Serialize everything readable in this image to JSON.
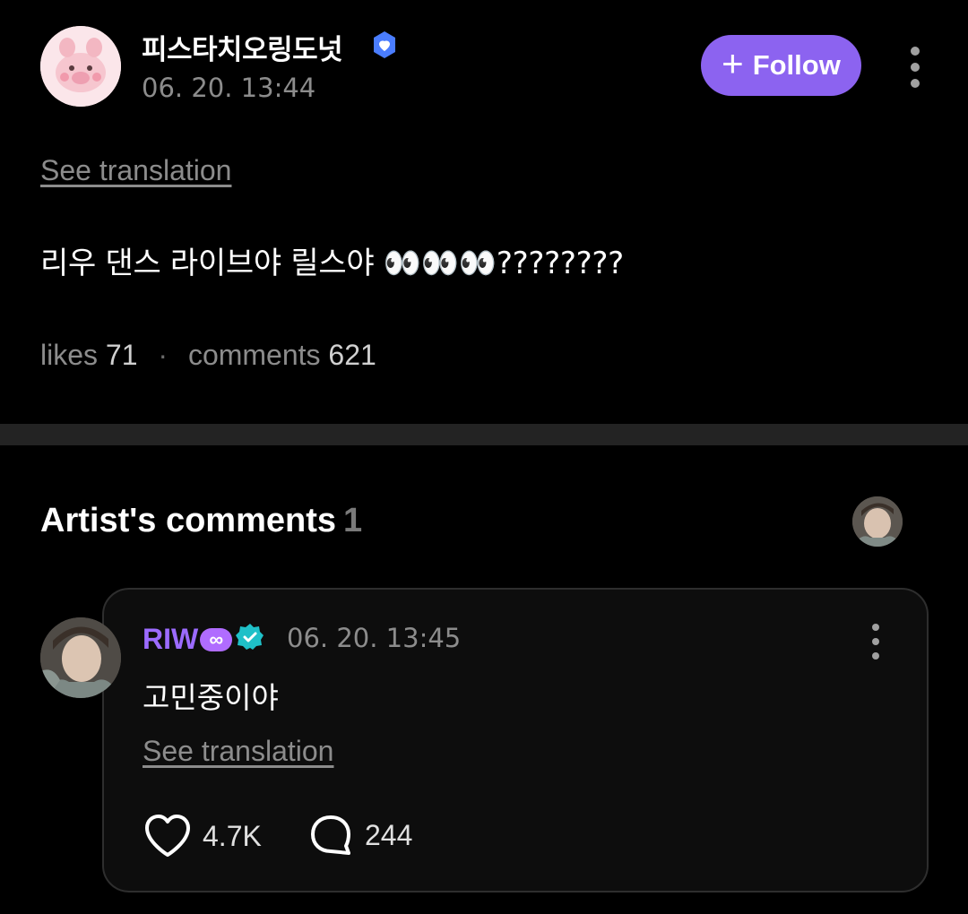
{
  "post": {
    "author": "피스타치오링도넛",
    "timestamp": "06. 20. 13:44",
    "follow_label": "Follow",
    "see_translation": "See translation",
    "body": "리우 댄스 라이브야 릴스야 👀👀👀????????",
    "likes_label": "likes",
    "likes_count": "71",
    "comments_label": "comments",
    "comments_count": "621"
  },
  "artist_comments": {
    "title": "Artist's comments",
    "count": "1"
  },
  "comment": {
    "author": "RIW",
    "author_badge": "∞",
    "timestamp": "06. 20. 13:45",
    "body": "고민중이야",
    "see_translation": "See translation",
    "likes": "4.7K",
    "replies": "244"
  },
  "colors": {
    "accent": "#8c63f0",
    "artist_name": "#9c6bff",
    "verified_blue": "#3d8bff",
    "verified_teal": "#1fc0c8",
    "muted": "#8c8c8c"
  },
  "icons": [
    "verified-badge-icon",
    "plus-icon",
    "more-vertical-icon",
    "heart-icon",
    "comment-bubble-icon"
  ]
}
